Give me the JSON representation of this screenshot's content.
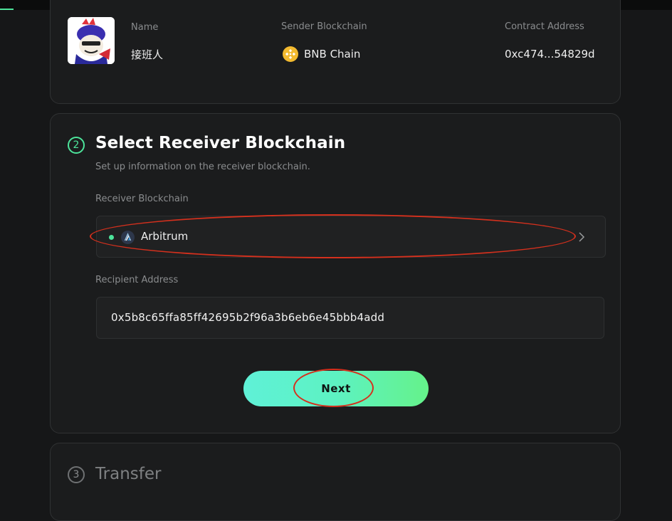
{
  "token_info": {
    "name_label": "Name",
    "name_value": "接班人",
    "sender_label": "Sender Blockchain",
    "sender_value": "BNB Chain",
    "contract_label": "Contract Address",
    "contract_value": "0xc474...54829d"
  },
  "step2": {
    "number": "2",
    "title": "Select Receiver Blockchain",
    "subtitle": "Set up information on the receiver blockchain.",
    "receiver_label": "Receiver Blockchain",
    "receiver_value": "Arbitrum",
    "recipient_label": "Recipient Address",
    "recipient_value": "0x5b8c65ffa85ff42695b2f96a3b6eb6e45bbb4add",
    "next_label": "Next"
  },
  "step3": {
    "number": "3",
    "title": "Transfer"
  },
  "colors": {
    "accent": "#4de59b",
    "annotation": "#d5301d",
    "bnb": "#f3ba2f",
    "arbitrum": "#2d374b"
  },
  "icons": {
    "avatar": "rooster-cartoon-avatar",
    "sender_chain": "bnb-chain-icon",
    "receiver_chain": "arbitrum-icon",
    "select_arrow": "chevron-right-icon"
  }
}
